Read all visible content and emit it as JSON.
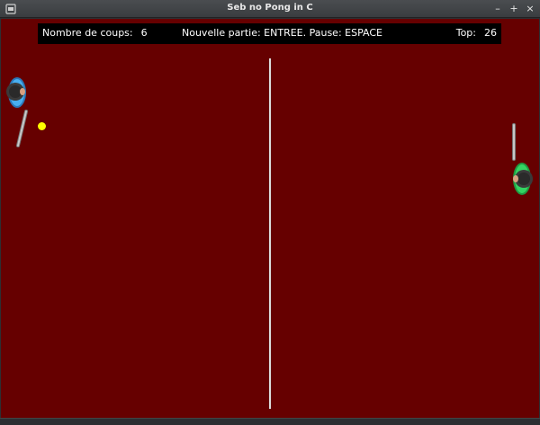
{
  "window": {
    "title": "Seb no Pong in C",
    "buttons": {
      "minimize": "–",
      "maximize": "+",
      "close": "×"
    }
  },
  "hud": {
    "hits_label": "Nombre de coups:",
    "hits_value": "6",
    "instructions": "Nouvelle partie: ENTREE. Pause: ESPACE",
    "top_label": "Top:",
    "top_value": "26"
  },
  "game": {
    "background_color": "#660000",
    "net_color": "#dcdcdc",
    "ball_color": "#ffff00",
    "left_player_color": "#3aa0e0",
    "right_player_color": "#2ecc55",
    "icons": {
      "left_player": "blue-player-icon",
      "right_player": "green-player-icon",
      "left_racket": "racket-icon",
      "right_racket": "racket-icon"
    }
  }
}
